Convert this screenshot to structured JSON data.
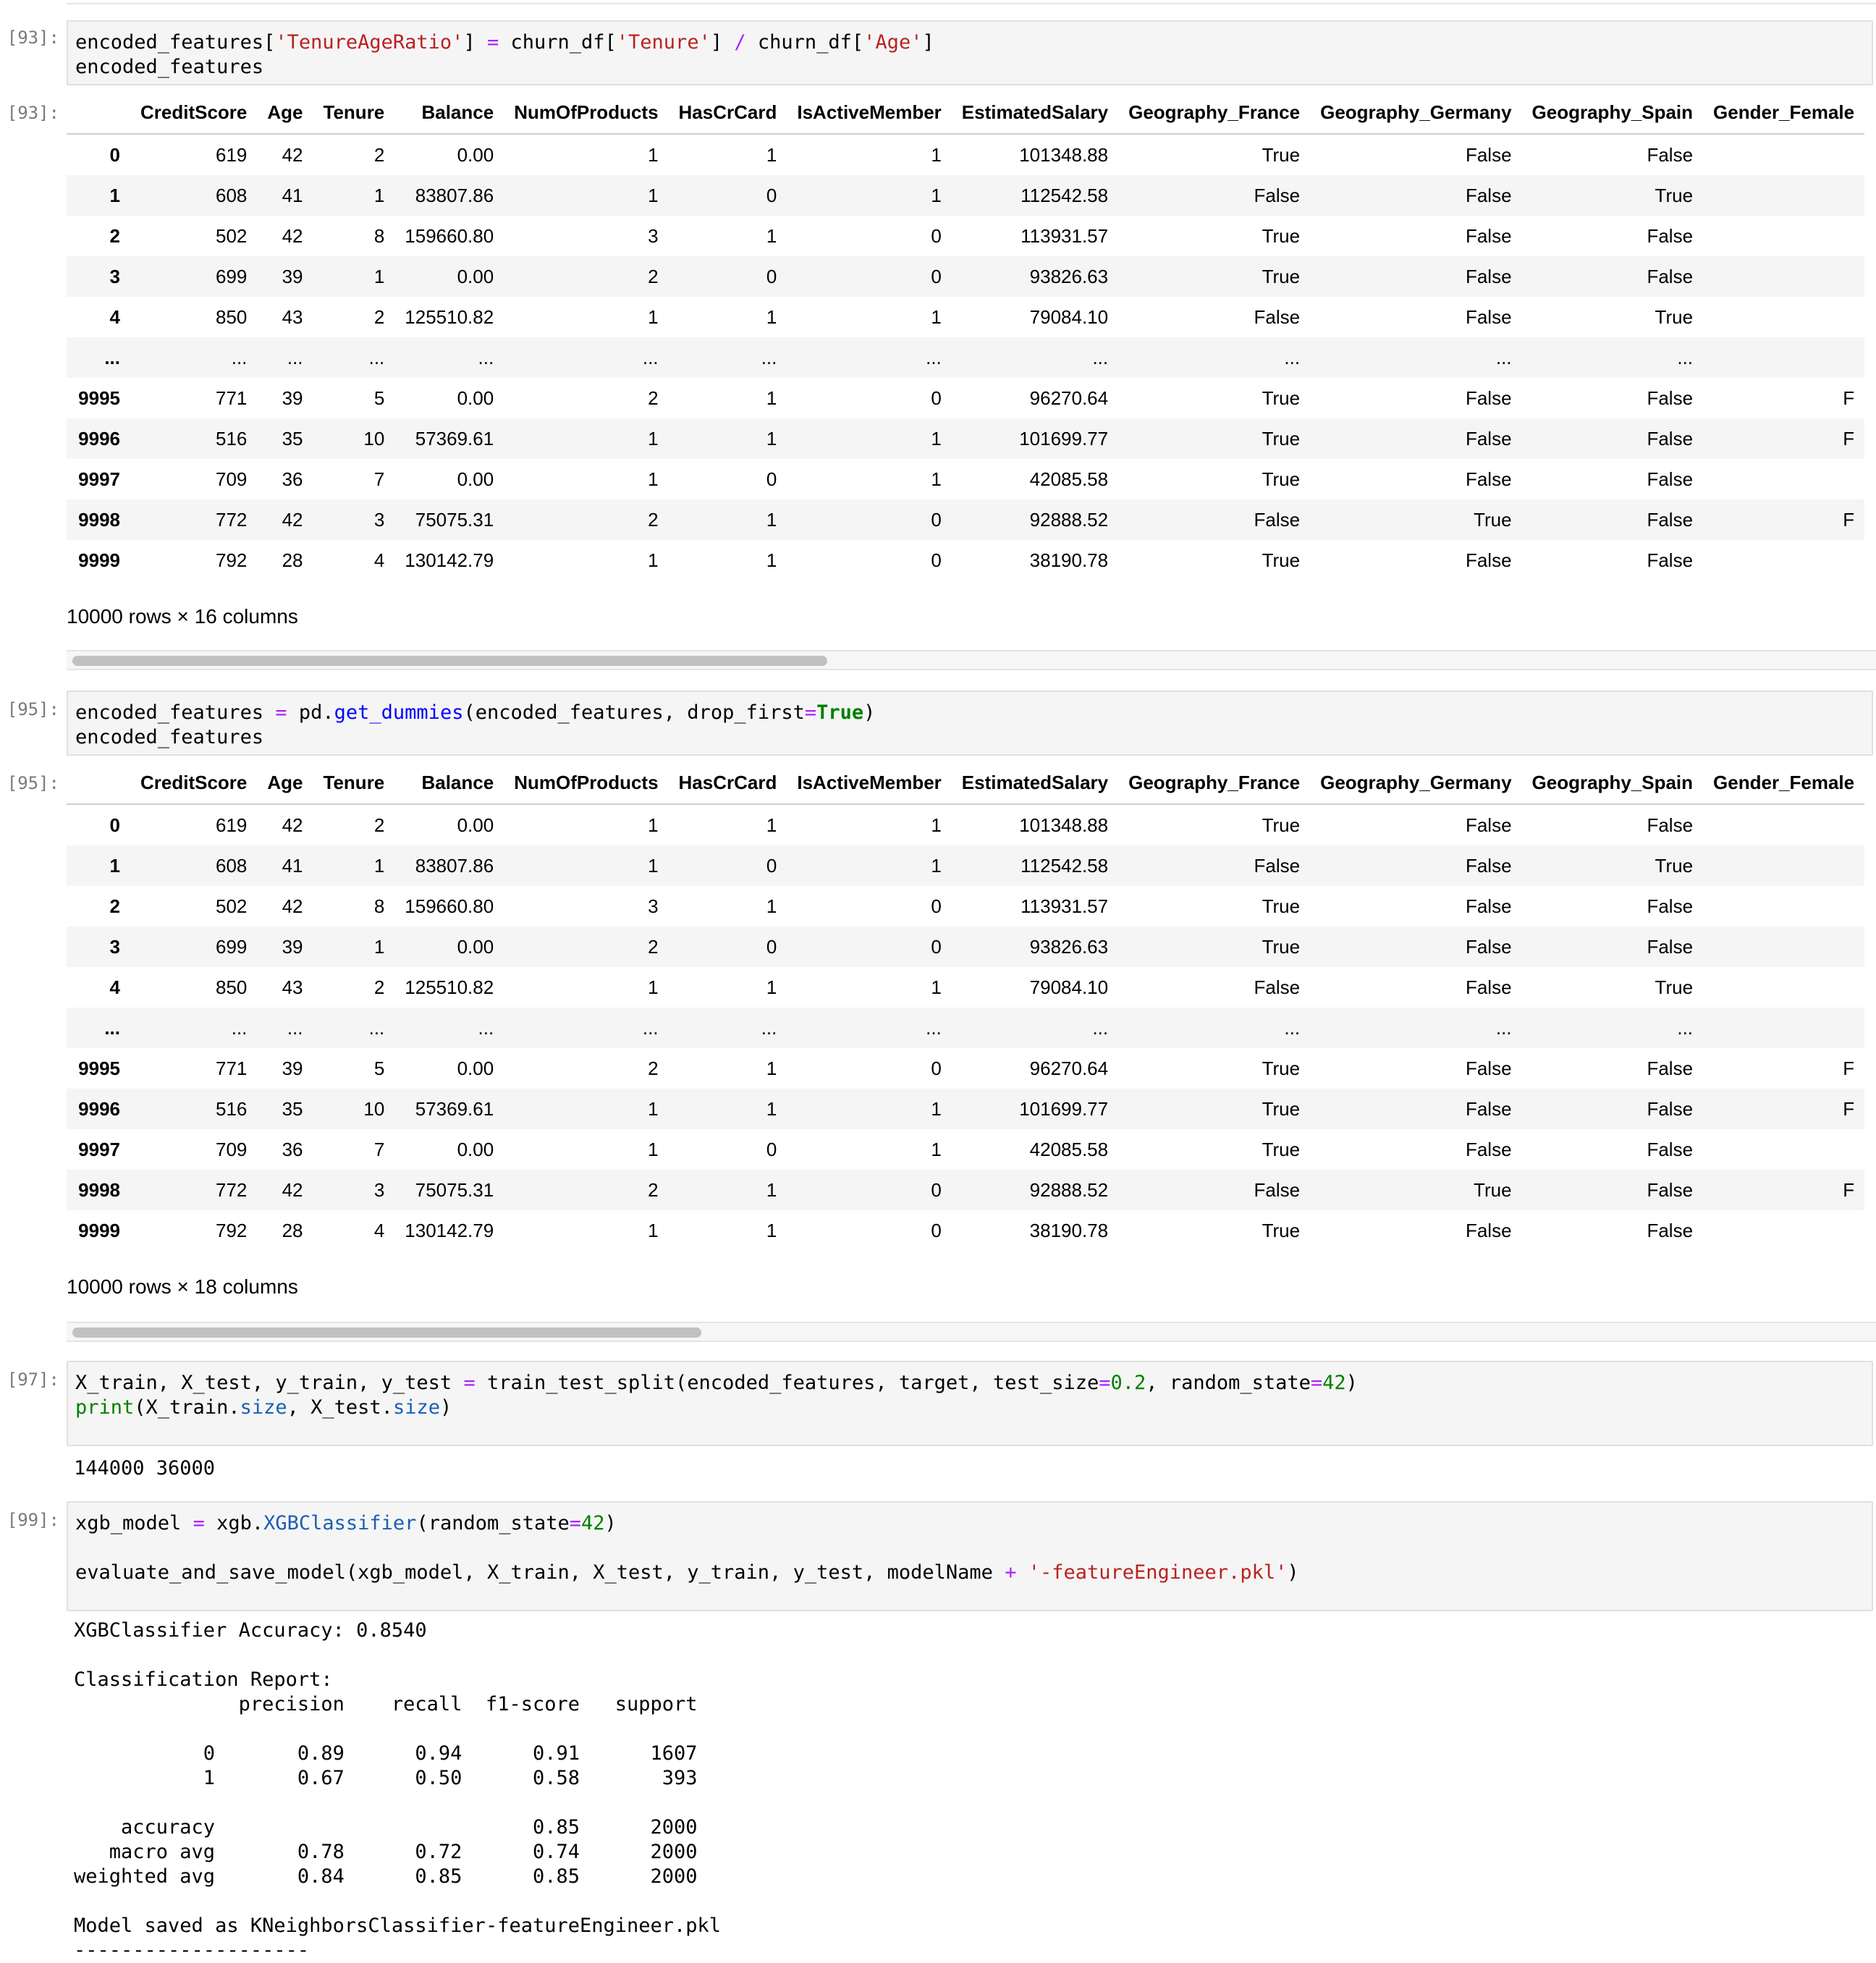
{
  "cells": [
    {
      "prompt": "[93]:",
      "code": [
        {
          "text": "encoded_features["
        },
        {
          "text": "'TenureAgeRatio'",
          "cls": "str"
        },
        {
          "text": "] "
        },
        {
          "text": "=",
          "cls": "op"
        },
        {
          "text": " churn_df["
        },
        {
          "text": "'Tenure'",
          "cls": "str"
        },
        {
          "text": "] "
        },
        {
          "text": "/",
          "cls": "op"
        },
        {
          "text": " churn_df["
        },
        {
          "text": "'Age'",
          "cls": "str"
        },
        {
          "text": "]\nencoded_features"
        }
      ],
      "output_prompt": "[93]:",
      "shape": "10000 rows × 16 columns"
    },
    {
      "prompt": "[95]:",
      "code": [
        {
          "text": "encoded_features "
        },
        {
          "text": "=",
          "cls": "op"
        },
        {
          "text": " pd."
        },
        {
          "text": "get_dummies",
          "cls": "fn"
        },
        {
          "text": "(encoded_features, drop_first"
        },
        {
          "text": "=",
          "cls": "op"
        },
        {
          "text": "True",
          "cls": "kw"
        },
        {
          "text": ")\nencoded_features"
        }
      ],
      "output_prompt": "[95]:",
      "shape": "10000 rows × 18 columns"
    },
    {
      "prompt": "[97]:",
      "code": [
        {
          "text": "X_train, X_test, y_train, y_test "
        },
        {
          "text": "=",
          "cls": "op"
        },
        {
          "text": " train_test_split(encoded_features, target, test_size"
        },
        {
          "text": "=",
          "cls": "op"
        },
        {
          "text": "0.2",
          "cls": "num"
        },
        {
          "text": ", random_state"
        },
        {
          "text": "=",
          "cls": "op"
        },
        {
          "text": "42",
          "cls": "num"
        },
        {
          "text": ")\n"
        },
        {
          "text": "print",
          "cls": "bi"
        },
        {
          "text": "(X_train."
        },
        {
          "text": "size",
          "cls": "attr"
        },
        {
          "text": ", X_test."
        },
        {
          "text": "size",
          "cls": "attr"
        },
        {
          "text": ")"
        }
      ],
      "output": "144000 36000"
    },
    {
      "prompt": "[99]:",
      "code": [
        {
          "text": "xgb_model "
        },
        {
          "text": "=",
          "cls": "op"
        },
        {
          "text": " xgb."
        },
        {
          "text": "XGBClassifier",
          "cls": "attr"
        },
        {
          "text": "(random_state"
        },
        {
          "text": "=",
          "cls": "op"
        },
        {
          "text": "42",
          "cls": "num"
        },
        {
          "text": ")\n\n"
        },
        {
          "text": "evaluate_and_save_model(xgb_model, X_train, X_test, y_train, y_test, modelName "
        },
        {
          "text": "+",
          "cls": "op"
        },
        {
          "text": " "
        },
        {
          "text": "'-featureEngineer.pkl'",
          "cls": "str"
        },
        {
          "text": ")"
        }
      ],
      "output": "XGBClassifier Accuracy: 0.8540\n\nClassification Report:\n              precision    recall  f1-score   support\n\n           0       0.89      0.94      0.91      1607\n           1       0.67      0.50      0.58       393\n\n    accuracy                           0.85      2000\n   macro avg       0.78      0.72      0.74      2000\nweighted avg       0.84      0.85      0.85      2000\n\nModel saved as KNeighborsClassifier-featureEngineer.pkl\n--------------------"
    }
  ],
  "table": {
    "columns": [
      "CreditScore",
      "Age",
      "Tenure",
      "Balance",
      "NumOfProducts",
      "HasCrCard",
      "IsActiveMember",
      "EstimatedSalary",
      "Geography_France",
      "Geography_Germany",
      "Geography_Spain",
      "Gender_Female"
    ],
    "rows": [
      {
        "index": "0",
        "cells": [
          "619",
          "42",
          "2",
          "0.00",
          "1",
          "1",
          "1",
          "101348.88",
          "True",
          "False",
          "False",
          ""
        ]
      },
      {
        "index": "1",
        "cells": [
          "608",
          "41",
          "1",
          "83807.86",
          "1",
          "0",
          "1",
          "112542.58",
          "False",
          "False",
          "True",
          ""
        ]
      },
      {
        "index": "2",
        "cells": [
          "502",
          "42",
          "8",
          "159660.80",
          "3",
          "1",
          "0",
          "113931.57",
          "True",
          "False",
          "False",
          ""
        ]
      },
      {
        "index": "3",
        "cells": [
          "699",
          "39",
          "1",
          "0.00",
          "2",
          "0",
          "0",
          "93826.63",
          "True",
          "False",
          "False",
          ""
        ]
      },
      {
        "index": "4",
        "cells": [
          "850",
          "43",
          "2",
          "125510.82",
          "1",
          "1",
          "1",
          "79084.10",
          "False",
          "False",
          "True",
          ""
        ]
      },
      {
        "index": "...",
        "cells": [
          "...",
          "...",
          "...",
          "...",
          "...",
          "...",
          "...",
          "...",
          "...",
          "...",
          "...",
          ""
        ]
      },
      {
        "index": "9995",
        "cells": [
          "771",
          "39",
          "5",
          "0.00",
          "2",
          "1",
          "0",
          "96270.64",
          "True",
          "False",
          "False",
          "F"
        ]
      },
      {
        "index": "9996",
        "cells": [
          "516",
          "35",
          "10",
          "57369.61",
          "1",
          "1",
          "1",
          "101699.77",
          "True",
          "False",
          "False",
          "F"
        ]
      },
      {
        "index": "9997",
        "cells": [
          "709",
          "36",
          "7",
          "0.00",
          "1",
          "0",
          "1",
          "42085.58",
          "True",
          "False",
          "False",
          ""
        ]
      },
      {
        "index": "9998",
        "cells": [
          "772",
          "42",
          "3",
          "75075.31",
          "2",
          "1",
          "0",
          "92888.52",
          "False",
          "True",
          "False",
          "F"
        ]
      },
      {
        "index": "9999",
        "cells": [
          "792",
          "28",
          "4",
          "130142.79",
          "1",
          "1",
          "0",
          "38190.78",
          "True",
          "False",
          "False",
          ""
        ]
      }
    ]
  },
  "scroll": [
    0.42,
    0.35
  ]
}
